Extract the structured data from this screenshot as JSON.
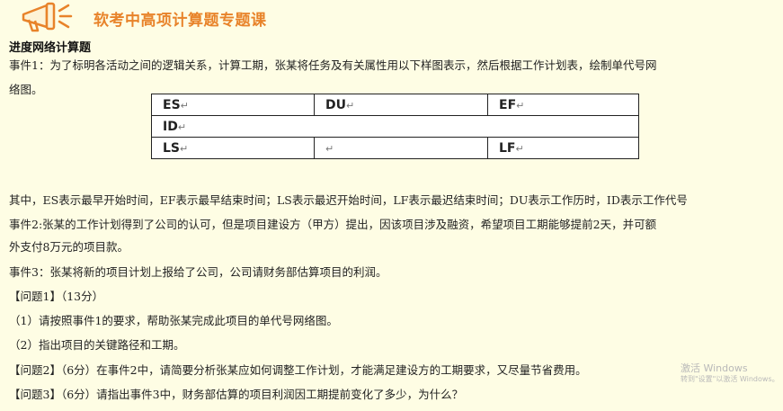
{
  "header": {
    "course_title": "软考中高项计算题专题课",
    "section_title": "进度网络计算题"
  },
  "event1": {
    "line1": "事件1：为了标明各活动之间的逻辑关系，计算工期，张某将任务及有关属性用以下样图表示，然后根据工作计划表，绘制单代号网",
    "line2": "络图。"
  },
  "legend_table": {
    "r1c1": "ES",
    "r1c2": "DU",
    "r1c3": "EF",
    "r2c1": "ID",
    "r3c1": "LS",
    "r3c2": "",
    "r3c3": "LF",
    "mark": "↵"
  },
  "body": {
    "legend_note": "其中，ES表示最早开始时间，EF表示最早结束时间；LS表示最迟开始时间，LF表示最迟结束时间；DU表示工作历时，ID表示工作代号",
    "event2_line1": "事件2:张某的工作计划得到了公司的认可，但是项目建设方（甲方）提出，因该项目涉及融资，希望项目工期能够提前2天，并可额",
    "event2_line2": "外支付8万元的项目款。",
    "event3": "事件3：张某将新的项目计划上报给了公司，公司请财务部估算项目的利润。",
    "q1_title": "【问题1】（13分）",
    "q1_a": "（1）请按照事件1的要求，帮助张某完成此项目的单代号网络图。",
    "q1_b": "（2）指出项目的关键路径和工期。",
    "q2": "【问题2】（6分）在事件2中，请简要分析张某应如何调整工作计划，才能满足建设方的工期要求，又尽量节省费用。",
    "q3": "【问题3】（6分）请指出事件3中，财务部估算的项目利润因工期提前变化了多少，为什么？"
  },
  "watermark": {
    "line1": "激活 Windows",
    "line2": "转到\"设置\"以激活 Windows。"
  },
  "colors": {
    "background": "#fefde4",
    "title_orange": "#e8832a"
  }
}
